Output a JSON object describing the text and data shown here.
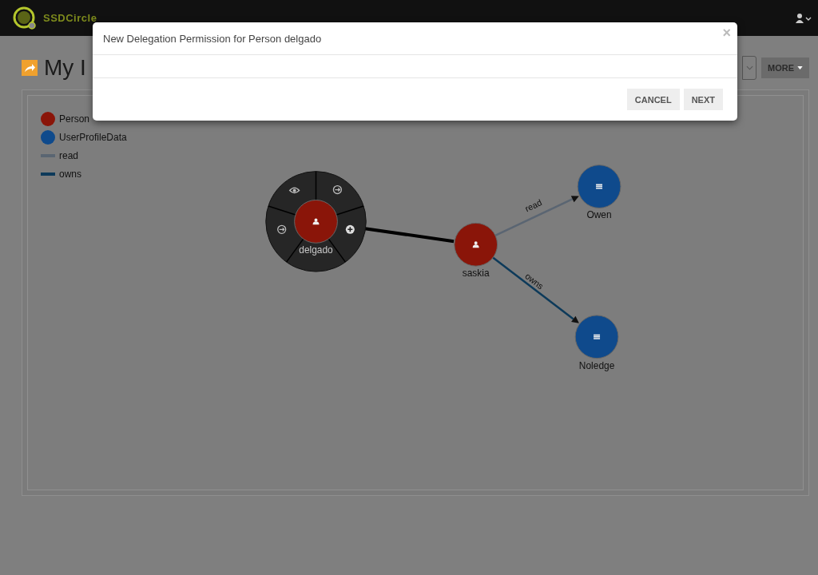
{
  "navbar": {
    "brand": "SSDCircle"
  },
  "page": {
    "title": "My I",
    "more_button": "MORE"
  },
  "legend": [
    {
      "label": "Person",
      "kind": "node",
      "color": "#8a1509"
    },
    {
      "label": "UserProfileData",
      "kind": "node",
      "color": "#0f4a8c"
    },
    {
      "label": "read",
      "kind": "edge",
      "color": "#5a6572"
    },
    {
      "label": "owns",
      "kind": "edge",
      "color": "#0d3a5a"
    }
  ],
  "graph": {
    "nodes": [
      {
        "label": "delgado",
        "kind": "person",
        "color": "#8a1509",
        "menu_open": true
      },
      {
        "label": "saskia",
        "kind": "person",
        "color": "#8a1509",
        "menu_open": false
      },
      {
        "label": "Owen",
        "kind": "data",
        "color": "#0f4a8c",
        "menu_open": false
      },
      {
        "label": "Noledge",
        "kind": "data",
        "color": "#0f4a8c",
        "menu_open": false
      }
    ],
    "edges": [
      {
        "kind": "selected",
        "color": "#000000"
      },
      {
        "kind": "arrow",
        "label": "read",
        "color": "#5a6572"
      },
      {
        "kind": "arrow",
        "label": "owns",
        "color": "#0d3a5a"
      }
    ]
  },
  "modal": {
    "title": "New Delegation Permission for Person delgado",
    "close": "×",
    "buttons": [
      "CANCEL",
      "NEXT"
    ]
  }
}
